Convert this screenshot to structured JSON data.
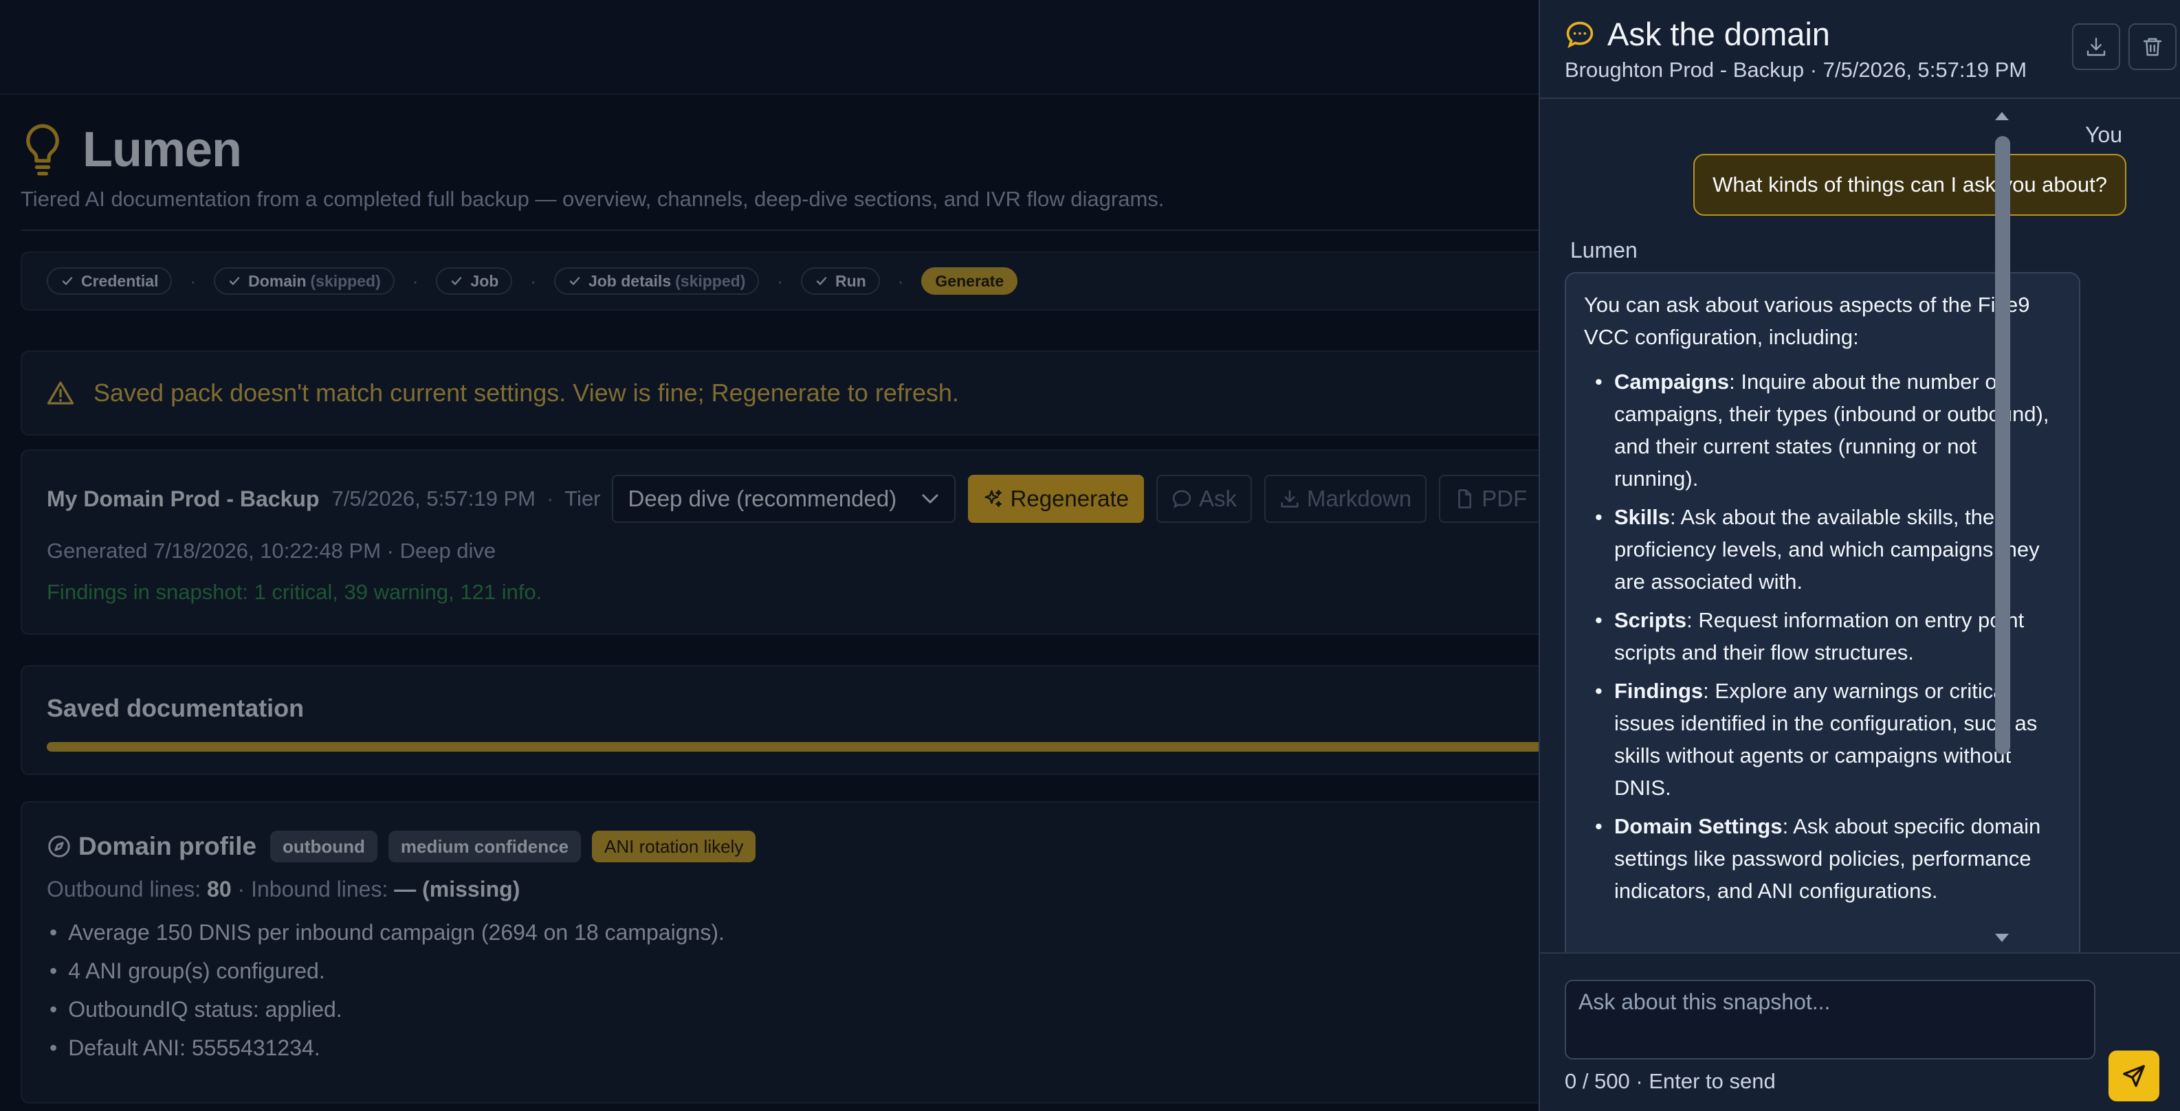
{
  "app": {
    "title": "Lumen",
    "subtitle": "Tiered AI documentation from a completed full backup — overview, channels, deep-dive sections, and IVR flow diagrams."
  },
  "steps": [
    {
      "label": "Credential",
      "note": ""
    },
    {
      "label": "Domain",
      "note": "(skipped)"
    },
    {
      "label": "Job",
      "note": ""
    },
    {
      "label": "Job details",
      "note": "(skipped)"
    },
    {
      "label": "Run",
      "note": ""
    },
    {
      "label": "Generate",
      "note": "",
      "active": true
    }
  ],
  "step_separator": "·",
  "warning": {
    "icon": "warning-triangle-icon",
    "text": "Saved pack doesn't match current settings. View is fine; Regenerate to refresh."
  },
  "pack": {
    "name": "My Domain Prod - Backup",
    "date": "7/5/2026, 5:57:19 PM",
    "tier_label": "Tier",
    "tier_value": "Deep dive (recommended)",
    "buttons": {
      "regenerate": "Regenerate",
      "ask": "Ask",
      "markdown": "Markdown",
      "pdf": "PDF"
    },
    "generated": "Generated 7/18/2026, 10:22:48 PM · Deep dive",
    "findings": "Findings in snapshot: 1 critical, 39 warning, 121 info."
  },
  "saved": {
    "title": "Saved documentation",
    "progress": 1.0
  },
  "profile": {
    "title": "Domain profile",
    "badges": [
      "outbound",
      "medium confidence",
      "ANI rotation likely"
    ],
    "outbound_label": "Outbound lines:",
    "outbound_value": "80",
    "inbound_label": "· Inbound lines:",
    "inbound_value": "— (missing)",
    "bullets": [
      "Average 150 DNIS per inbound campaign (2694 on 18 campaigns).",
      "4 ANI group(s) configured.",
      "OutboundIQ status: applied.",
      "Default ANI: 5555431234."
    ]
  },
  "chat": {
    "title": "Ask the domain",
    "subtitle": "Broughton Prod - Backup · 7/5/2026, 5:57:19 PM",
    "you_label": "You",
    "user_message": "What kinds of things can I ask you about?",
    "bot_label": "Lumen",
    "bot_intro": "You can ask about various aspects of the Five9 VCC configuration, including:",
    "bot_items": [
      {
        "term": "Campaigns",
        "text": ": Inquire about the number of campaigns, their types (inbound or outbound), and their current states (running or not running)."
      },
      {
        "term": "Skills",
        "text": ": Ask about the available skills, their proficiency levels, and which campaigns they are associated with."
      },
      {
        "term": "Scripts",
        "text": ": Request information on entry point scripts and their flow structures."
      },
      {
        "term": "Findings",
        "text": ": Explore any warnings or critical issues identified in the configuration, such as skills without agents or campaigns without DNIS."
      },
      {
        "term": "Domain Settings",
        "text": ": Ask about specific domain settings like password policies, performance indicators, and ANI configurations."
      }
    ],
    "input_placeholder": "Ask about this snapshot...",
    "counter": "0 / 500 · Enter to send"
  },
  "colors": {
    "accent": "#e5b120",
    "warning_text": "#d8b445",
    "findings_text": "#2f8a49",
    "panel_bg": "#162033",
    "page_bg": "#0b1120"
  }
}
